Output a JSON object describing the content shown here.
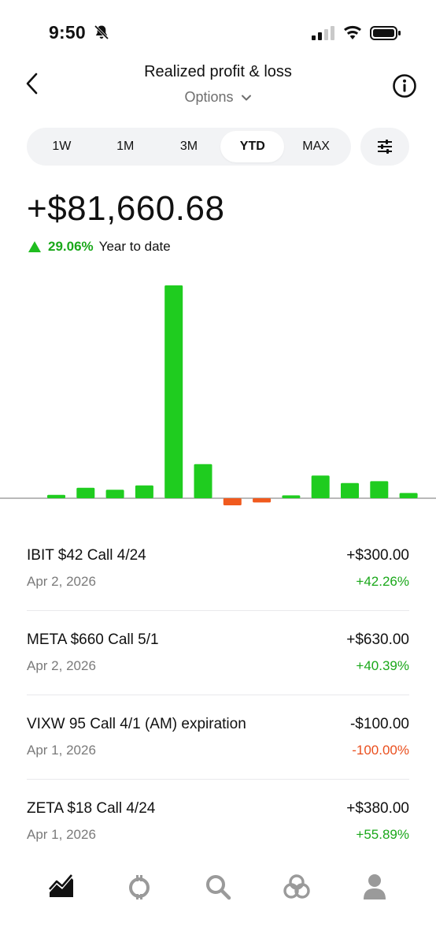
{
  "status": {
    "time": "9:50"
  },
  "header": {
    "title": "Realized profit & loss",
    "subtitle": "Options"
  },
  "ranges": [
    {
      "label": "1W",
      "active": false
    },
    {
      "label": "1M",
      "active": false
    },
    {
      "label": "3M",
      "active": false
    },
    {
      "label": "YTD",
      "active": true
    },
    {
      "label": "MAX",
      "active": false
    }
  ],
  "summary": {
    "total": "+$81,660.68",
    "change_pct": "29.06%",
    "change_label": "Year to date"
  },
  "colors": {
    "positive": "#1fcc1f",
    "negative": "#f05a1e",
    "positive_text": "#1aa81a",
    "negative_text": "#ea4f1e"
  },
  "chart_data": {
    "type": "bar",
    "categories": [
      "",
      "",
      "",
      "",
      "",
      "",
      "",
      "",
      "",
      "",
      "",
      "",
      "",
      ""
    ],
    "values": [
      0.7,
      2.2,
      1.8,
      2.7,
      45,
      7.2,
      -1.5,
      -0.9,
      0.6,
      4.8,
      3.2,
      3.6,
      1.1,
      0
    ],
    "ylim": [
      -3,
      47
    ],
    "grid": false
  },
  "transactions": [
    {
      "name": "IBIT $42 Call 4/24",
      "date": "Apr 2, 2026",
      "amount": "+$300.00",
      "pct": "+42.26%",
      "positive": true
    },
    {
      "name": "META $660 Call 5/1",
      "date": "Apr 2, 2026",
      "amount": "+$630.00",
      "pct": "+40.39%",
      "positive": true
    },
    {
      "name": "VIXW 95 Call 4/1 (AM) expiration",
      "date": "Apr 1, 2026",
      "amount": "-$100.00",
      "pct": "-100.00%",
      "positive": false
    },
    {
      "name": "ZETA $18 Call 4/24",
      "date": "Apr 1, 2026",
      "amount": "+$380.00",
      "pct": "+55.89%",
      "positive": true
    }
  ],
  "nav": [
    {
      "icon": "investing-icon",
      "active": true
    },
    {
      "icon": "crypto-icon",
      "active": false
    },
    {
      "icon": "search-icon",
      "active": false
    },
    {
      "icon": "network-icon",
      "active": false
    },
    {
      "icon": "account-icon",
      "active": false
    }
  ]
}
